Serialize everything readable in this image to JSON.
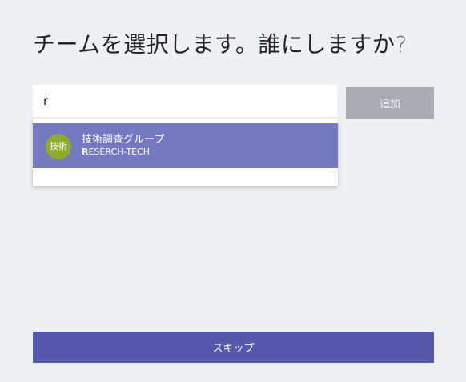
{
  "page": {
    "title": "チームを選択します。誰にしますか",
    "title_question_mark": "?"
  },
  "search": {
    "value": "r",
    "placeholder": ""
  },
  "add_button": {
    "label": "追加"
  },
  "suggestions": [
    {
      "avatar_text": "技術",
      "name": "技術調査グループ",
      "alias_match": "R",
      "alias_rest": "ESERCH-TECH"
    }
  ],
  "skip_button": {
    "label": "スキップ"
  },
  "colors": {
    "background": "#edf0f5",
    "accent": "#5459ac",
    "selected_suggestion": "#7579c1",
    "avatar": "#8fad2b",
    "disabled_button": "#a8acb5"
  },
  "icons": {
    "avatar": "team-avatar-initials"
  }
}
